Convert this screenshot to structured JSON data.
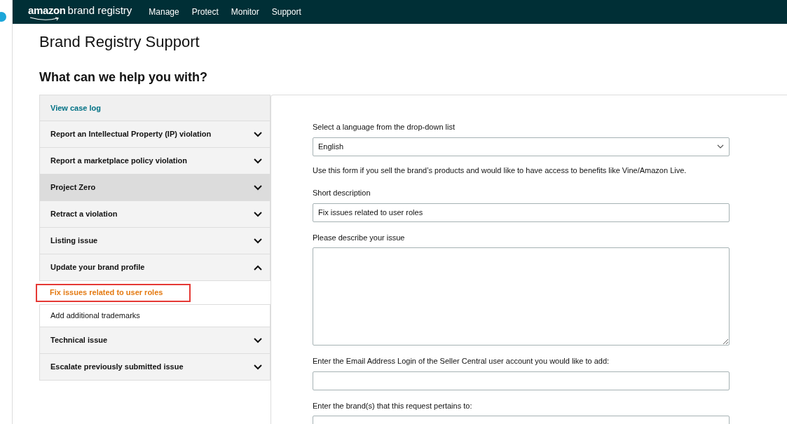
{
  "nav": {
    "logo_word": "amazon",
    "logo_rest": "brand registry",
    "items": [
      "Manage",
      "Protect",
      "Monitor",
      "Support"
    ]
  },
  "page_title": "Brand Registry Support",
  "subtitle": "What can we help you with?",
  "sidebar": {
    "items": [
      {
        "kind": "link",
        "label": "View case log"
      },
      {
        "kind": "section",
        "label": "Report an Intellectual Property (IP) violation",
        "expanded": false,
        "selected": false
      },
      {
        "kind": "section",
        "label": "Report a marketplace policy violation",
        "expanded": false,
        "selected": false
      },
      {
        "kind": "section",
        "label": "Project Zero",
        "expanded": false,
        "selected": true
      },
      {
        "kind": "section",
        "label": "Retract a violation",
        "expanded": false,
        "selected": false
      },
      {
        "kind": "section",
        "label": "Listing issue",
        "expanded": false,
        "selected": false
      },
      {
        "kind": "section",
        "label": "Update your brand profile",
        "expanded": true,
        "selected": false,
        "children": [
          {
            "label": "Fix issues related to user roles",
            "selected": true
          },
          {
            "label": "Add additional trademarks",
            "selected": false
          }
        ]
      },
      {
        "kind": "section",
        "label": "Technical issue",
        "expanded": false,
        "selected": false
      },
      {
        "kind": "section",
        "label": "Escalate previously submitted issue",
        "expanded": false,
        "selected": false
      }
    ]
  },
  "form": {
    "fields": [
      {
        "kind": "select",
        "label": "Select a language from the drop-down list",
        "value": "English"
      },
      {
        "kind": "note",
        "label": "Use this form if you sell the brand’s products and would like to have access to benefits like Vine/Amazon Live."
      },
      {
        "kind": "input",
        "label": "Short description",
        "value": "Fix issues related to user roles"
      },
      {
        "kind": "textarea",
        "label": "Please describe your issue"
      },
      {
        "kind": "input",
        "label": "Enter the Email Address Login of the Seller Central user account you would like to add:"
      },
      {
        "kind": "input",
        "label": "Enter the brand(s) that this request pertains to:"
      }
    ]
  }
}
